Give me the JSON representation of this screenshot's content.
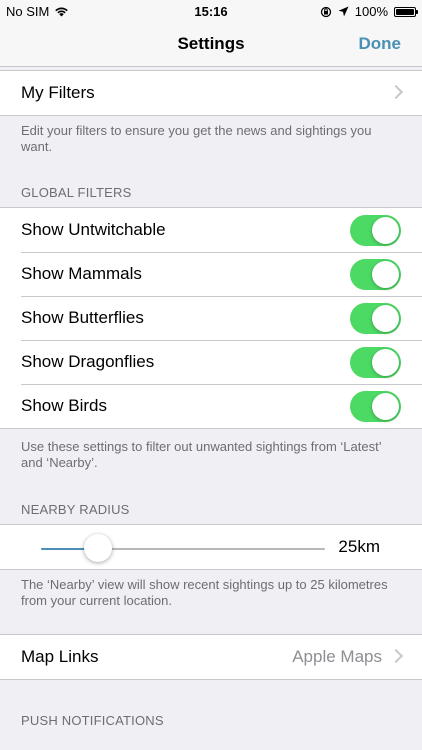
{
  "status": {
    "carrier": "No SIM",
    "time": "15:16",
    "battery": "100%",
    "battery_level": 1.0
  },
  "nav": {
    "title": "Settings",
    "done": "Done"
  },
  "filters": {
    "my_filters": "My Filters",
    "footer": "Edit your filters to ensure you get the news and sightings you want."
  },
  "global": {
    "header": "GLOBAL FILTERS",
    "items": [
      {
        "label": "Show Untwitchable",
        "on": true
      },
      {
        "label": "Show Mammals",
        "on": true
      },
      {
        "label": "Show Butterflies",
        "on": true
      },
      {
        "label": "Show Dragonflies",
        "on": true
      },
      {
        "label": "Show Birds",
        "on": true
      }
    ],
    "footer": "Use these settings to filter out unwanted sightings from ‘Latest’ and ‘Nearby’."
  },
  "radius": {
    "header": "NEARBY RADIUS",
    "value": "25km",
    "slider_fraction": 0.2,
    "footer": "The ‘Nearby’ view will show recent sightings up to 25 kilometres from your current location."
  },
  "maps": {
    "label": "Map Links",
    "value": "Apple Maps"
  },
  "push": {
    "header": "PUSH NOTIFICATIONS"
  },
  "colors": {
    "accent": "#4a8fb5",
    "toggle_on": "#4cd964",
    "background": "#efeff4"
  }
}
